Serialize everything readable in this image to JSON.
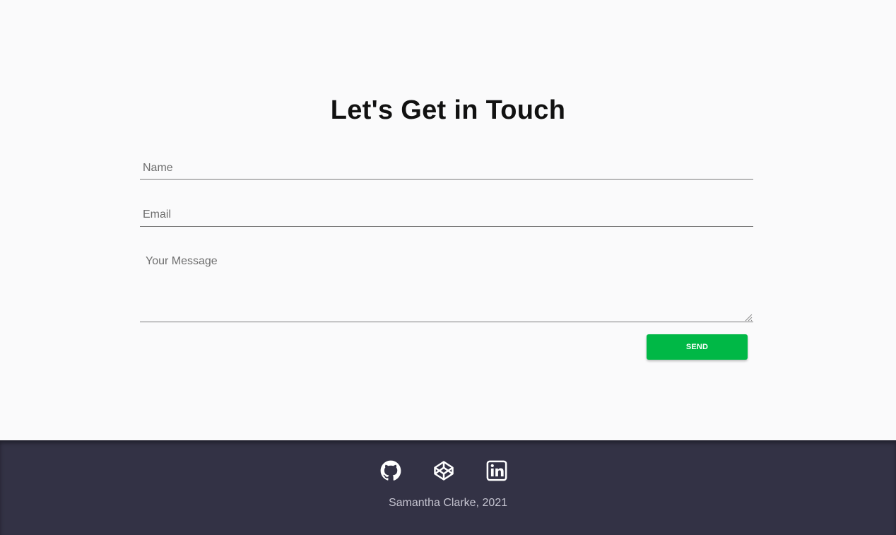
{
  "contact": {
    "title": "Let's Get in Touch",
    "name_placeholder": "Name",
    "email_placeholder": "Email",
    "message_placeholder": "Your Message",
    "send_label": "SEND"
  },
  "footer": {
    "icons": [
      "github-icon",
      "codepen-icon",
      "linkedin-icon"
    ],
    "credit": "Samantha Clarke, 2021"
  },
  "colors": {
    "background": "#fafafb",
    "footer_background": "#333245",
    "send_button": "#00b846"
  }
}
